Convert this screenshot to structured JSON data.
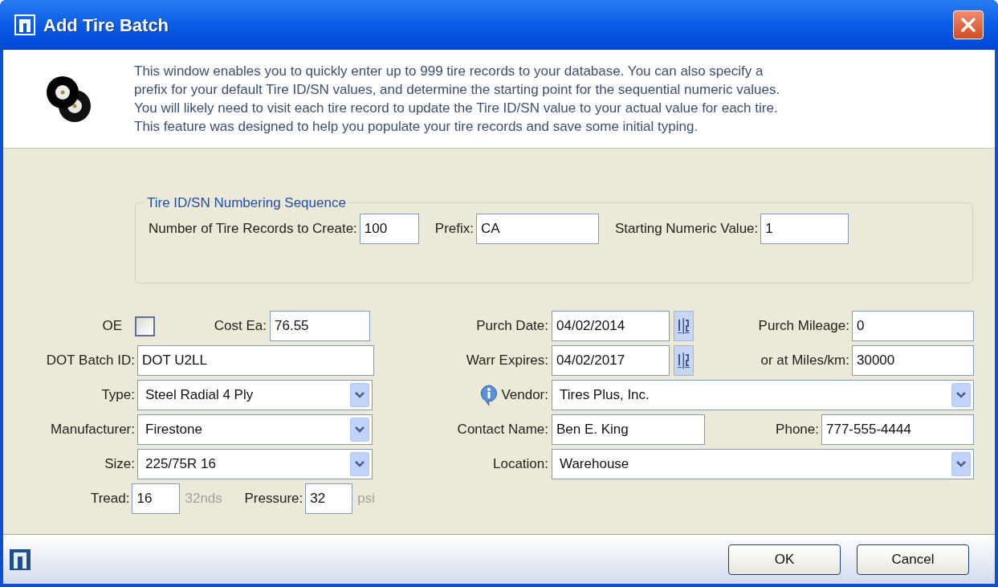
{
  "window": {
    "title": "Add Tire Batch"
  },
  "description_lines": [
    "This window enables you to quickly enter up to 999 tire records to your database. You can also specify a",
    "prefix for your default Tire ID/SN values, and determine the starting point for the sequential numeric values.",
    "You will likely need to visit each tire record to update the Tire ID/SN value to your actual value for each tire.",
    "This feature was designed to help you populate your tire records and save some initial typing."
  ],
  "numbering": {
    "legend": "Tire ID/SN Numbering Sequence",
    "fields": [
      {
        "label": "Number of Tire Records to Create:",
        "value": "100"
      },
      {
        "label": "Prefix:",
        "value": "CA"
      },
      {
        "label": "Starting Numeric Value:",
        "value": "1"
      }
    ]
  },
  "oe": {
    "label": "OE",
    "checked": false
  },
  "cost_ea": {
    "label": "Cost Ea:",
    "value": "76.55"
  },
  "dot_batch_id": {
    "label": "DOT Batch ID:",
    "value": "DOT U2LL"
  },
  "type": {
    "label": "Type:",
    "value": "Steel Radial 4 Ply"
  },
  "manufacturer": {
    "label": "Manufacturer:",
    "value": "Firestone"
  },
  "size": {
    "label": "Size:",
    "value": "225/75R 16"
  },
  "tread": {
    "label": "Tread:",
    "value": "16",
    "unit": "32nds"
  },
  "pressure": {
    "label": "Pressure:",
    "value": "32",
    "unit": "psi"
  },
  "purch_date": {
    "label": "Purch Date:",
    "value": "04/02/2014"
  },
  "warr_expires": {
    "label": "Warr Expires:",
    "value": "04/02/2017"
  },
  "purch_mileage": {
    "label": "Purch Mileage:",
    "value": "0"
  },
  "miles_km": {
    "label": "or at Miles/km:",
    "value": "30000"
  },
  "vendor": {
    "label": "Vendor:",
    "value": "Tires Plus, Inc."
  },
  "contact_name": {
    "label": "Contact Name:",
    "value": "Ben E. King"
  },
  "phone": {
    "label": "Phone:",
    "value": "777-555-4444"
  },
  "location": {
    "label": "Location:",
    "value": "Warehouse"
  },
  "buttons": [
    "OK",
    "Cancel"
  ]
}
